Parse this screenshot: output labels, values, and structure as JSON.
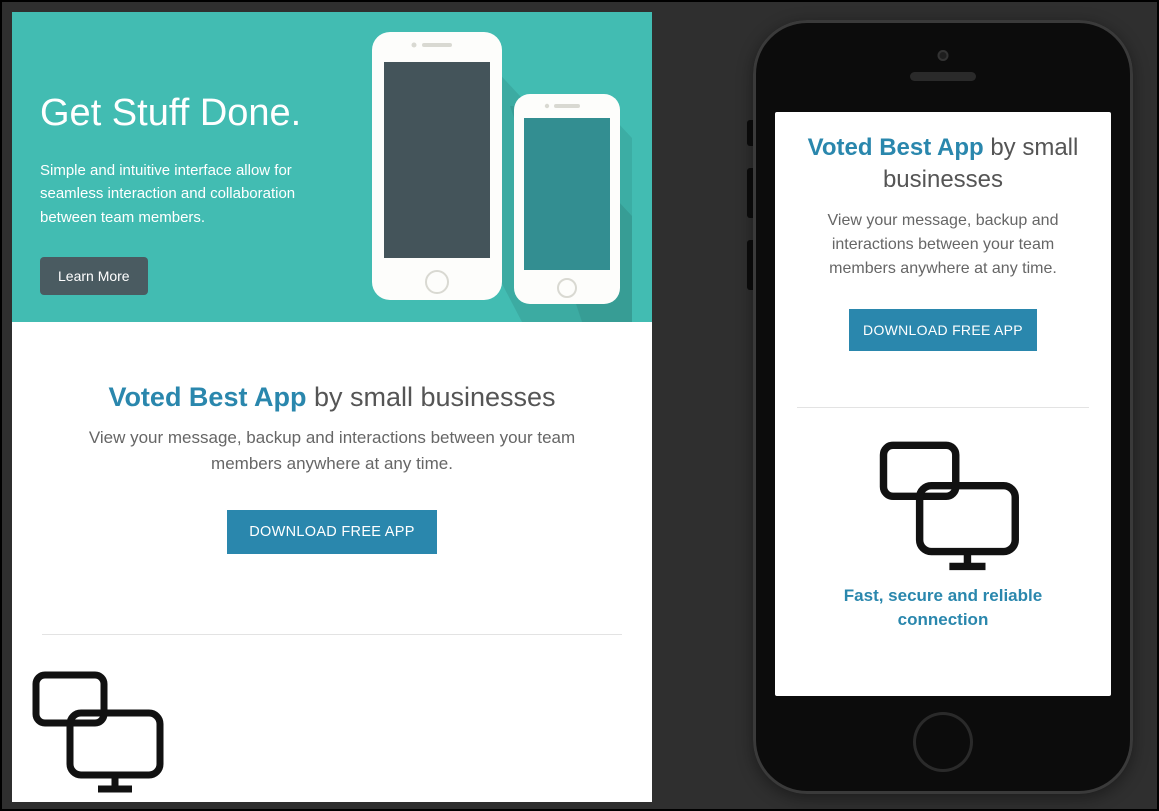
{
  "hero": {
    "title": "Get Stuff Done.",
    "subtitle": "Simple and intuitive interface allow for seamless interaction and collaboration between team members.",
    "learn_more": "Learn More"
  },
  "voted": {
    "accent": "Voted Best App",
    "rest": " by small businesses",
    "subtitle": "View your message, backup and interactions between your team members anywhere at any time.",
    "download": "DOWNLOAD FREE APP"
  },
  "feature": {
    "title": "Fast, secure and reliable connection"
  },
  "colors": {
    "teal": "#42bcb2",
    "accent": "#2a87ad",
    "dark_button": "#4a5b61"
  }
}
